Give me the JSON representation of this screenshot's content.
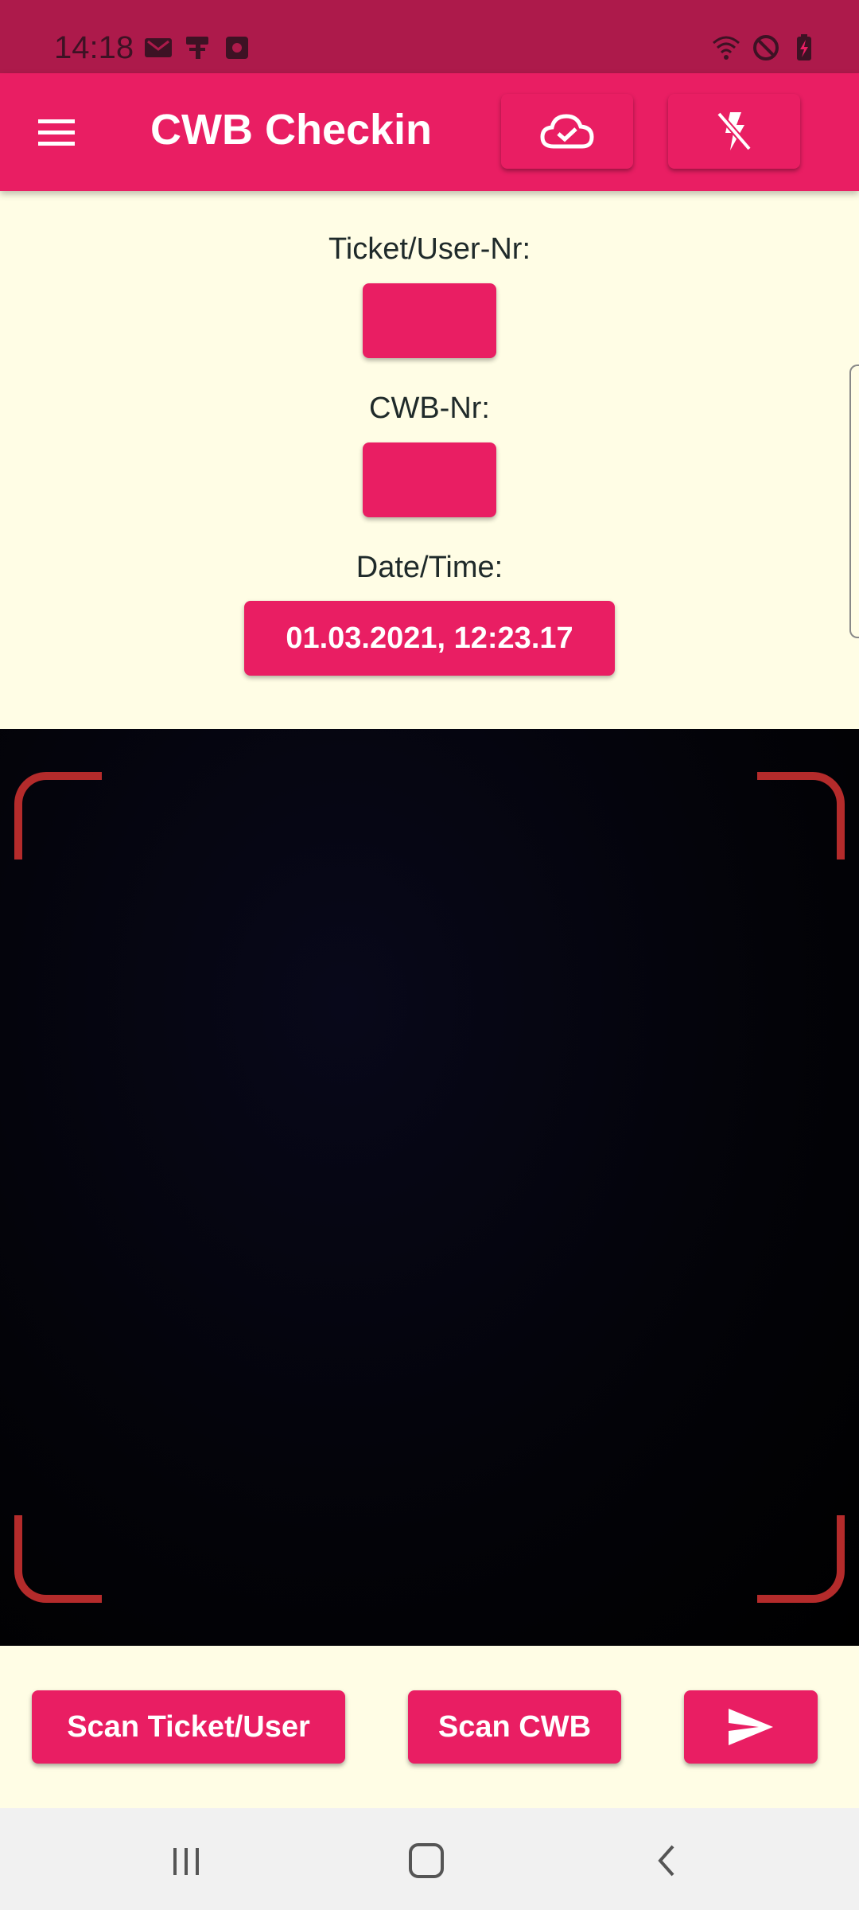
{
  "status_bar": {
    "time": "14:18",
    "left_icons": [
      "gmail-icon",
      "paint-roller-icon",
      "screen-record-icon"
    ],
    "right_icons": [
      "wifi-icon",
      "do-not-disturb-icon",
      "battery-charging-icon"
    ]
  },
  "app_bar": {
    "title": "CWB Checkin",
    "menu_icon": "menu-icon",
    "cloud_button_icon": "cloud-check-icon",
    "flash_button_icon": "flash-off-icon"
  },
  "form": {
    "ticket_label": "Ticket/User-Nr:",
    "ticket_value": "",
    "cwb_label": "CWB-Nr:",
    "cwb_value": "",
    "datetime_label": "Date/Time:",
    "datetime_value": "01.03.2021, 12:23.17"
  },
  "actions": {
    "scan_ticket_label": "Scan Ticket/User",
    "scan_cwb_label": "Scan CWB",
    "send_icon": "send-icon"
  },
  "nav_bar": {
    "recents_icon": "recents-icon",
    "home_icon": "home-icon",
    "back_icon": "back-icon"
  },
  "colors": {
    "status_bar": "#AD1A4B",
    "primary": "#E91E63",
    "background": "#FFFDE5",
    "scanner_corner": "#B42B2B",
    "nav_bar": "#F1F1F1"
  }
}
